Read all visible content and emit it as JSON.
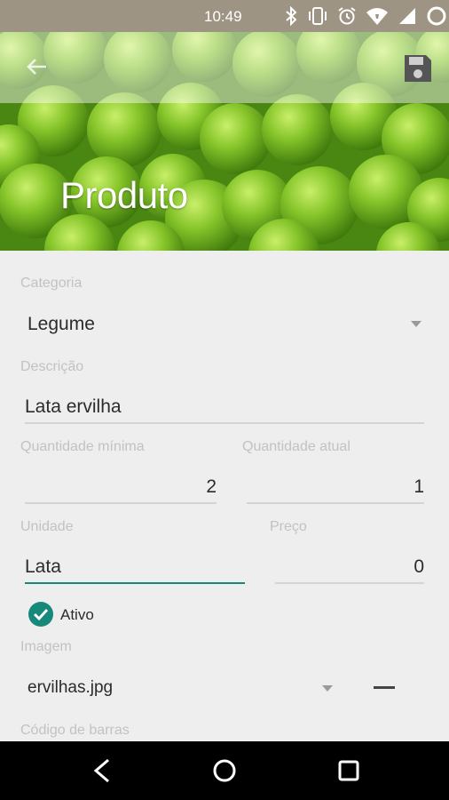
{
  "status_bar": {
    "time": "10:49",
    "icons": [
      "bluetooth-icon",
      "vibrate-icon",
      "alarm-icon",
      "wifi-icon",
      "signal-icon",
      "battery-icon"
    ]
  },
  "header": {
    "title": "Produto",
    "back_icon": "arrow-back-icon",
    "save_icon": "save-icon"
  },
  "form": {
    "categoria": {
      "label": "Categoria",
      "value": "Legume"
    },
    "descricao": {
      "label": "Descrição",
      "value": "Lata ervilha"
    },
    "quantidade_minima": {
      "label": "Quantidade mínima",
      "value": "2"
    },
    "quantidade_atual": {
      "label": "Quantidade atual",
      "value": "1"
    },
    "unidade": {
      "label": "Unidade",
      "value": "Lata"
    },
    "preco": {
      "label": "Preço",
      "value": "0"
    },
    "ativo": {
      "label": "Ativo",
      "checked": true
    },
    "imagem": {
      "label": "Imagem",
      "value": "ervilhas.jpg"
    },
    "codigo_barras": {
      "label": "Código de barras"
    }
  },
  "colors": {
    "accent": "#16897a",
    "status_bar": "#9e9484",
    "background": "#eeeeee"
  },
  "navigation": [
    "back-icon",
    "home-icon",
    "recents-icon"
  ]
}
